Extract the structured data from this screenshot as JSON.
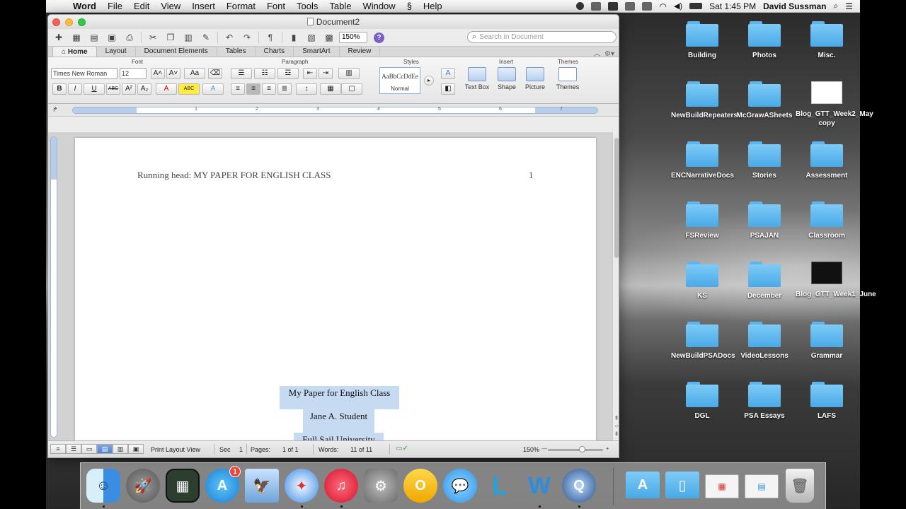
{
  "menubar": {
    "app_name": "Word",
    "items": [
      "File",
      "Edit",
      "View",
      "Insert",
      "Format",
      "Font",
      "Tools",
      "Table",
      "Window",
      "Help"
    ],
    "clock": "Sat 1:45 PM",
    "user": "David Sussman"
  },
  "window": {
    "title": "Document2"
  },
  "toolbar": {
    "zoom": "150%",
    "search_placeholder": "Search in Document"
  },
  "ribbon": {
    "tabs": [
      "Home",
      "Layout",
      "Document Elements",
      "Tables",
      "Charts",
      "SmartArt",
      "Review"
    ],
    "active_tab": "Home",
    "groups": {
      "font": "Font",
      "paragraph": "Paragraph",
      "styles": "Styles",
      "insert": "Insert",
      "themes": "Themes"
    },
    "font_name": "Times New Roman",
    "font_size": "12",
    "style_sample": "AaBbCcDdEe",
    "style_name": "Normal",
    "insert_buttons": [
      "Text Box",
      "Shape",
      "Picture"
    ],
    "themes_button": "Themes"
  },
  "ruler": {
    "marks": [
      "1",
      "2",
      "3",
      "4",
      "5",
      "6",
      "7"
    ]
  },
  "document": {
    "running_head": "Running head: MY PAPER FOR ENGLISH CLASS",
    "page_number": "1",
    "title_lines": [
      "My Paper for English Class",
      "Jane A. Student",
      "Full Sail University"
    ]
  },
  "statusbar": {
    "view_name": "Print Layout View",
    "sec_label": "Sec",
    "sec_value": "1",
    "pages_label": "Pages:",
    "pages_value": "1 of 1",
    "words_label": "Words:",
    "words_value": "11 of 11",
    "zoom": "150%"
  },
  "desktop": {
    "icons": [
      {
        "label": "Building",
        "kind": "folder"
      },
      {
        "label": "Photos",
        "kind": "folder"
      },
      {
        "label": "Misc.",
        "kind": "folder"
      },
      {
        "label": "NewBuildRepeaters",
        "kind": "folder"
      },
      {
        "label": "McGrawASheets",
        "kind": "folder"
      },
      {
        "label": "Blog_GTT_Week2_May copy",
        "kind": "thumb-white"
      },
      {
        "label": "ENCNarrativeDocs",
        "kind": "folder"
      },
      {
        "label": "Stories",
        "kind": "folder"
      },
      {
        "label": "Assessment",
        "kind": "folder"
      },
      {
        "label": "FSReview",
        "kind": "folder"
      },
      {
        "label": "PSAJAN",
        "kind": "folder"
      },
      {
        "label": "Classroom",
        "kind": "folder"
      },
      {
        "label": "KS",
        "kind": "folder"
      },
      {
        "label": "December",
        "kind": "folder"
      },
      {
        "label": "Blog_GTT_Week1_June",
        "kind": "thumb-dark"
      },
      {
        "label": "NewBuildPSADocs",
        "kind": "folder"
      },
      {
        "label": "VideoLessons",
        "kind": "folder"
      },
      {
        "label": "Grammar",
        "kind": "folder"
      },
      {
        "label": "DGL",
        "kind": "folder"
      },
      {
        "label": "PSA Essays",
        "kind": "folder"
      },
      {
        "label": "LAFS",
        "kind": "folder"
      }
    ]
  },
  "dock": {
    "app_store_badge": "1",
    "apps": [
      "finder-icon",
      "launchpad-icon",
      "photo-booth-icon",
      "app-store-icon",
      "preview-icon",
      "safari-icon",
      "itunes-icon",
      "system-preferences-icon",
      "outlook-icon",
      "messages-icon",
      "lync-icon",
      "word-icon",
      "quicktime-icon"
    ],
    "right_items": [
      "applications-folder-icon",
      "documents-folder-icon",
      "downloads-stack-icon",
      "recent-screenshot-icon",
      "trash-icon"
    ]
  },
  "colors": {
    "folder_blue": "#5eb4ec",
    "selection": "#c6daf2",
    "help_purple": "#7a5fc4",
    "badge_red": "#f0433a"
  }
}
